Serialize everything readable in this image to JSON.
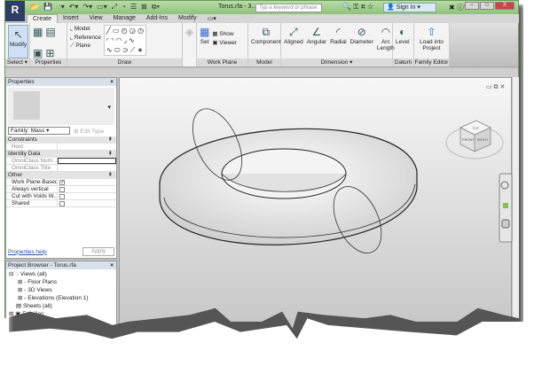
{
  "titlebar": {
    "logo": "R",
    "title": "Torus.rfa - 3...",
    "search_placeholder": "Typ a keyword or phrase",
    "sign_in": "Sign In",
    "help": "?"
  },
  "tabs": [
    {
      "label": "Create",
      "active": true
    },
    {
      "label": "Insert"
    },
    {
      "label": "View"
    },
    {
      "label": "Manage"
    },
    {
      "label": "Add-Ins"
    },
    {
      "label": "Modify"
    }
  ],
  "ribbon": {
    "select": {
      "modify": "Modify",
      "label": "Select ▾"
    },
    "properties": {
      "label": "Properties"
    },
    "draw": {
      "model": "Model",
      "reference": "Reference",
      "plane": "Plane",
      "label": "Draw"
    },
    "work_plane": {
      "set": "Set",
      "show": "Show",
      "viewer": "Viewer",
      "label": "Work Plane"
    },
    "model": {
      "component": "Component",
      "label": "Model"
    },
    "dimension": {
      "aligned": "Aligned",
      "angular": "Angular",
      "radial": "Radial",
      "diameter": "Diameter",
      "arc_length": "Arc Length",
      "label": "Dimension ▾"
    },
    "datum": {
      "level": "Level",
      "label": "Datum"
    },
    "family_editor": {
      "load": "Load into Project",
      "label": "Family Editor"
    }
  },
  "properties": {
    "title": "Properties",
    "family": "Family: Mass",
    "edit_type": "Edit Type",
    "groups": [
      {
        "name": "Constraints",
        "rows": [
          {
            "k": "Host",
            "v": ""
          }
        ]
      },
      {
        "name": "Identity Data",
        "rows": [
          {
            "k": "OmniClass Num...",
            "v": ""
          },
          {
            "k": "OmniClass Title",
            "v": ""
          }
        ]
      },
      {
        "name": "Other",
        "rows": [
          {
            "k": "Work Plane-Based",
            "check": true
          },
          {
            "k": "Always vertical",
            "check": false
          },
          {
            "k": "Cut with Voids W...",
            "check": false
          },
          {
            "k": "Shared",
            "check": false
          }
        ]
      }
    ],
    "help": "Properties help",
    "apply": "Apply"
  },
  "project_browser": {
    "title": "Project Browser - Torus.rfa",
    "items": [
      "Views (all)",
      "Floor Plans",
      "3D Views",
      "Elevations (Elevation 1)",
      "Sheets (all)",
      "Families"
    ]
  },
  "viewcube": {
    "top": "TOP",
    "front": "FRONT",
    "right": "RIGHT"
  },
  "colors": {
    "title_green": "#8fc27a",
    "ribbon_bg": "#f3f3f3"
  }
}
